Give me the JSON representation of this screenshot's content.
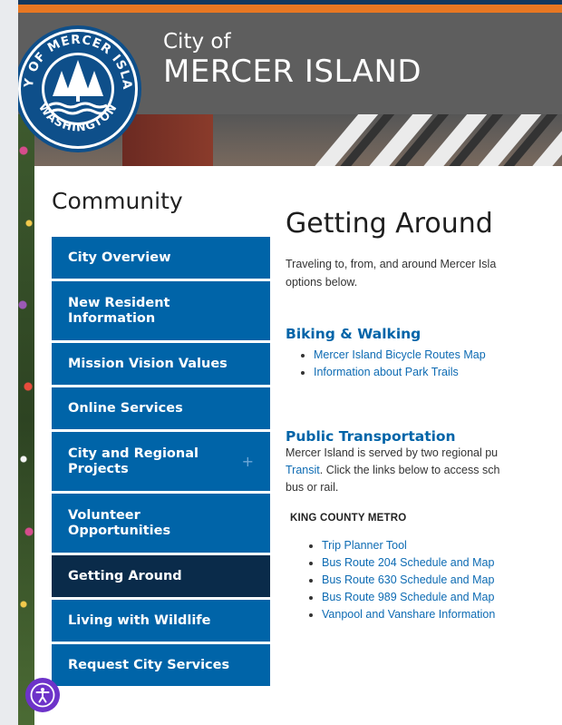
{
  "header": {
    "city_of": "City of",
    "city_name": "MERCER ISLAND",
    "seal_text_top": "CITY OF MERCER ISLAND",
    "seal_text_bottom": "WASHINGTON"
  },
  "sidebar": {
    "heading": "Community",
    "items": [
      {
        "label": "City Overview",
        "active": false,
        "expandable": false
      },
      {
        "label": "New Resident Information",
        "active": false,
        "expandable": false
      },
      {
        "label": "Mission Vision Values",
        "active": false,
        "expandable": false
      },
      {
        "label": "Online Services",
        "active": false,
        "expandable": false
      },
      {
        "label": "City and Regional Projects",
        "active": false,
        "expandable": true
      },
      {
        "label": "Volunteer Opportunities",
        "active": false,
        "expandable": false
      },
      {
        "label": "Getting Around",
        "active": true,
        "expandable": false
      },
      {
        "label": "Living with Wildlife",
        "active": false,
        "expandable": false
      },
      {
        "label": "Request City Services",
        "active": false,
        "expandable": false
      }
    ],
    "expand_symbol": "+"
  },
  "main": {
    "title": "Getting Around",
    "intro_line1": "Traveling to, from, and around Mercer Isla",
    "intro_line2": "options below.",
    "biking": {
      "heading": "Biking & Walking",
      "links": [
        "Mercer Island Bicycle Routes Map",
        "Information about Park Trails"
      ]
    },
    "public": {
      "heading": "Public Transportation",
      "line1": "Mercer Island is served by two regional pu",
      "line2_link": "Transit",
      "line2_rest": ". Click the links below to access sch",
      "line3": "bus or rail.",
      "metro_heading": "KING COUNTY METRO",
      "metro_links": [
        "Trip Planner Tool",
        "Bus Route 204 Schedule and Map",
        "Bus Route 630 Schedule and Map",
        "Bus Route 989 Schedule and Map",
        "Vanpool and Vanshare Information"
      ]
    }
  },
  "accessibility": {
    "icon": "accessibility-icon"
  },
  "colors": {
    "nav_blue": "#0064a8",
    "nav_active": "#0a2b4a",
    "accent_orange": "#e87722",
    "link_blue": "#0d6bb3",
    "a11y_purple": "#6d33c9"
  }
}
